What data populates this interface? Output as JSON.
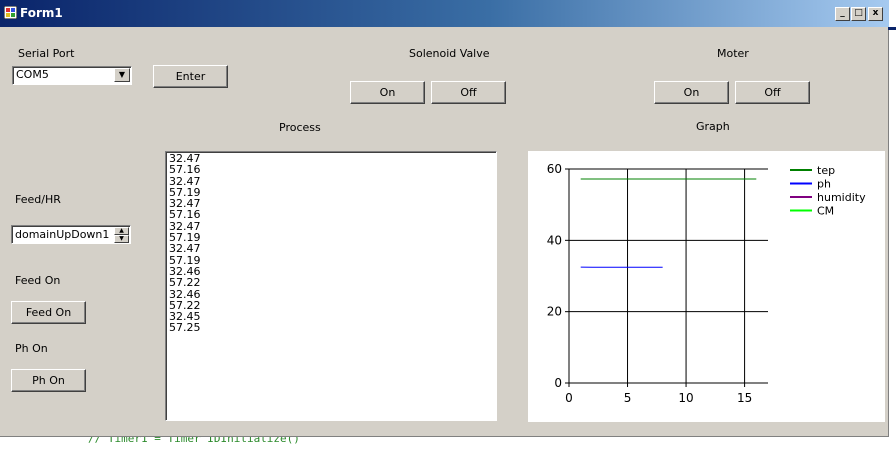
{
  "window": {
    "title": "Form1",
    "buttons": {
      "minimize": "_",
      "maximize": "□",
      "close": "x"
    }
  },
  "background_code": "// Timer1 = Timer  IDInitialize()",
  "serial_port": {
    "label": "Serial Port",
    "value": "COM5",
    "enter_button": "Enter"
  },
  "solenoid": {
    "label": "Solenoid Valve",
    "on_button": "On",
    "off_button": "Off"
  },
  "moter": {
    "label": "Moter",
    "on_button": "On",
    "off_button": "Off"
  },
  "process": {
    "label": "Process",
    "lines": [
      "32.47",
      "57.16",
      "32.47",
      "57.19",
      "32.47",
      "57.16",
      "32.47",
      "57.19",
      "32.47",
      "57.19",
      "32.46",
      "57.22",
      "32.46",
      "57.22",
      "32.45",
      "57.25"
    ]
  },
  "feed": {
    "label": "Feed/HR",
    "updown_value": "domainUpDown1",
    "feed_on_label": "Feed On",
    "feed_on_button": "Feed On"
  },
  "ph": {
    "label": "Ph On",
    "button": "Ph On"
  },
  "graph": {
    "label": "Graph"
  },
  "chart_data": {
    "type": "line",
    "title": "",
    "xlabel": "",
    "ylabel": "",
    "xlim": [
      0,
      17
    ],
    "ylim": [
      0,
      60
    ],
    "xticks": [
      0,
      5,
      10,
      15
    ],
    "yticks": [
      0,
      20,
      40,
      60
    ],
    "grid": true,
    "legend_position": "top-right",
    "series": [
      {
        "name": "tep",
        "color": "#008000",
        "x": [
          1,
          16
        ],
        "y": [
          57.2,
          57.2
        ]
      },
      {
        "name": "ph",
        "color": "#0000ff",
        "x": [
          1,
          2,
          3,
          4,
          5,
          6,
          7,
          8
        ],
        "y": [
          32.5,
          32.47,
          32.47,
          32.47,
          32.47,
          32.46,
          32.46,
          32.45
        ]
      },
      {
        "name": "humidity",
        "color": "#800080",
        "x": [],
        "y": []
      },
      {
        "name": "CM",
        "color": "#00ff00",
        "x": [],
        "y": []
      }
    ]
  }
}
